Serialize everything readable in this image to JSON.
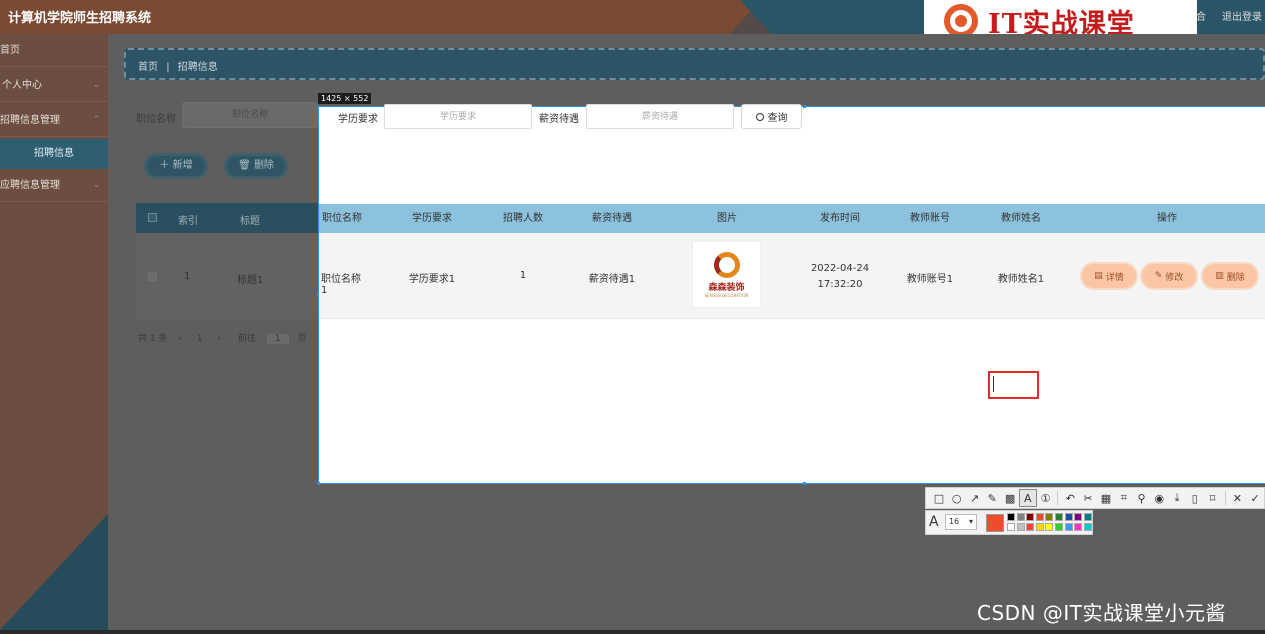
{
  "app": {
    "title": "计算机学院师生招聘系统",
    "top_right": [
      "合",
      "退出登录"
    ]
  },
  "brand": {
    "text": "IT实战课堂",
    "logo_icon": "chrome-like-logo-icon"
  },
  "sidebar": {
    "items": [
      {
        "label": "首页"
      },
      {
        "label": "个人中心"
      },
      {
        "label": "招聘信息管理"
      },
      {
        "label": "应聘信息管理"
      }
    ],
    "active_sub": "招聘信息"
  },
  "breadcrumb": {
    "home": "首页",
    "sep": "|",
    "current": "招聘信息"
  },
  "background_page": {
    "search_label": "职位名称",
    "search_placeholder": "职位名称",
    "add_button": "新增",
    "delete_button": "删除",
    "table_headers": [
      "索引",
      "标题"
    ],
    "row": {
      "index": "1",
      "title": "标题1"
    },
    "pager": {
      "total": "共 1 条",
      "page": "1",
      "goto_label": "前往",
      "goto_value": "1",
      "page_suffix": "页"
    }
  },
  "capture": {
    "size_tag": "1425 × 552",
    "search": [
      {
        "label": "学历要求",
        "placeholder": "学历要求"
      },
      {
        "label": "薪资待遇",
        "placeholder": "薪资待遇"
      }
    ],
    "query_button": "查询",
    "table": {
      "headers": [
        "职位名称",
        "学历要求",
        "招聘人数",
        "薪资待遇",
        "图片",
        "发布时间",
        "教师账号",
        "教师姓名",
        "操作"
      ],
      "row": {
        "position": "职位名称1",
        "education": "学历要求1",
        "count": "1",
        "salary": "薪资待遇1",
        "image": {
          "name": "森森装饰",
          "sub": "SENSEN DECORATION"
        },
        "published": "2022-04-24 17:32:20",
        "teacher_account": "教师账号1",
        "teacher_name": "教师姓名1"
      },
      "actions": [
        "详情",
        "修改",
        "删除"
      ]
    }
  },
  "screenshot_tool": {
    "tools": [
      "rectangle-icon",
      "ellipse-icon",
      "arrow-icon",
      "pencil-icon",
      "mosaic-icon",
      "text-icon",
      "number-icon",
      "undo-icon",
      "crop-icon",
      "ocr-icon",
      "pin-icon",
      "record-icon",
      "save-icon",
      "copy-icon",
      "bookmark-icon",
      "close-icon",
      "confirm-icon"
    ],
    "font_size": "16",
    "current_color": "#ef4b2c",
    "palette": [
      "#000000",
      "#808080",
      "#800000",
      "#ef4b2c",
      "#808000",
      "#2e7d32",
      "#1e4fa0",
      "#800080",
      "#008080",
      "#ffffff",
      "#c0c0c0",
      "#ff4040",
      "#ffd700",
      "#ffff00",
      "#33cc33",
      "#3399ff",
      "#ff33cc",
      "#00cccc"
    ]
  },
  "watermark": "CSDN @IT实战课堂小元酱"
}
